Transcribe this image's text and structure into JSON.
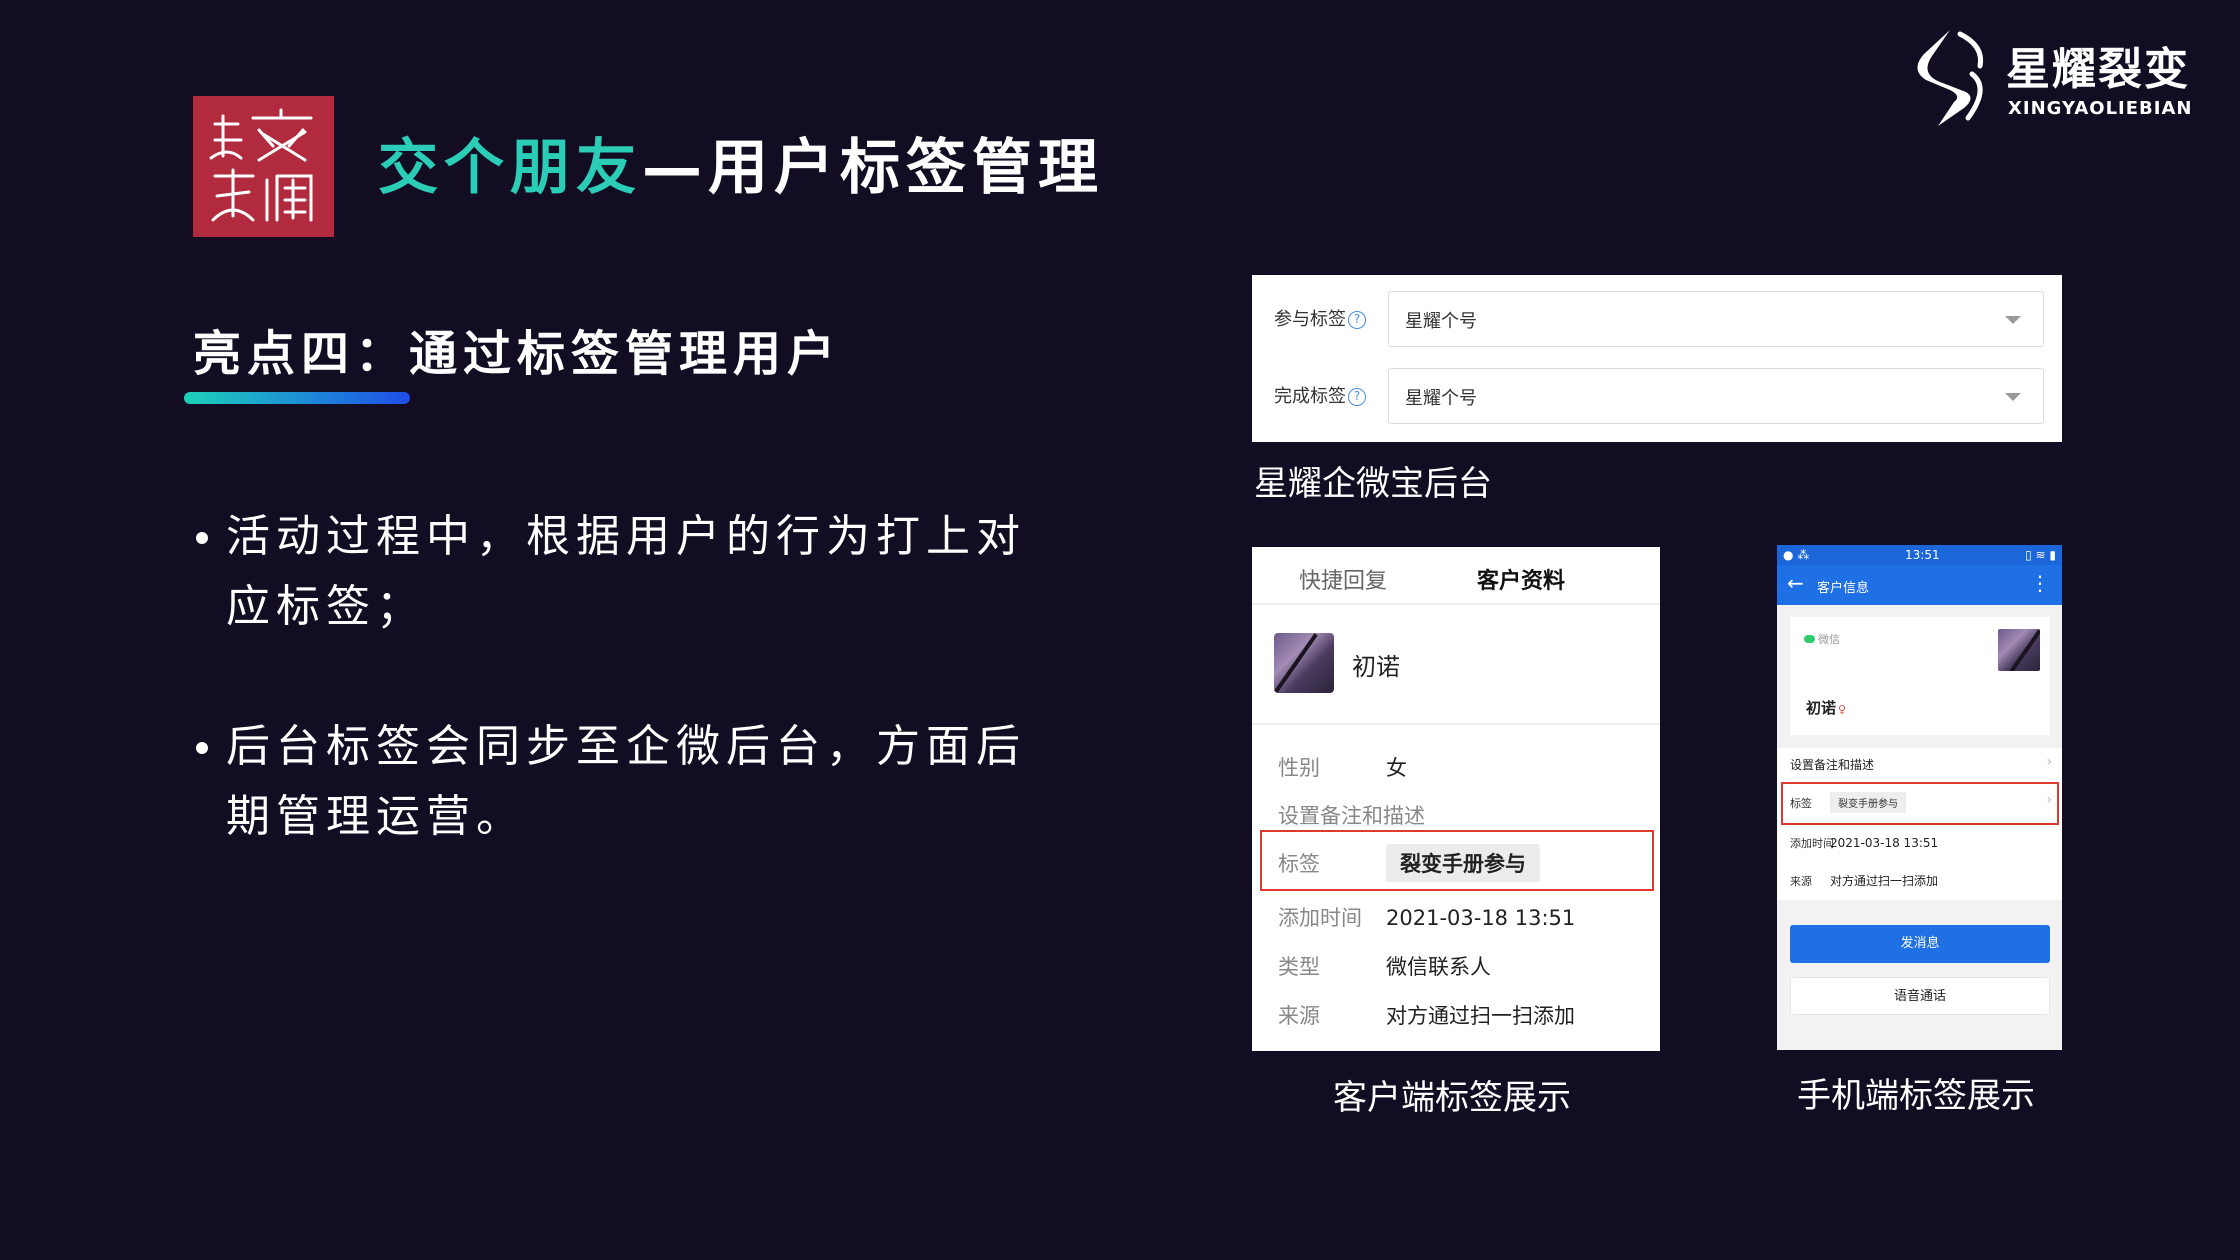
{
  "header": {
    "logo_text": "交个朋友",
    "title_accent": "交个朋友",
    "title_rest": "—用户标签管理"
  },
  "brand": {
    "name_cn": "星耀裂变",
    "name_en": "XINGYAOLIEBIAN"
  },
  "section": {
    "heading": "亮点四：通过标签管理用户"
  },
  "bullets": [
    "活动过程中，根据用户的行为打上对应标签；",
    "后台标签会同步至企微后台，方面后期管理运营。"
  ],
  "backend_panel": {
    "rows": [
      {
        "label": "参与标签",
        "value": "星耀个号"
      },
      {
        "label": "完成标签",
        "value": "星耀个号"
      }
    ],
    "help_icon": "question-circle-icon",
    "caption": "星耀企微宝后台"
  },
  "desktop_panel": {
    "tabs": [
      "快捷回复",
      "客户资料"
    ],
    "contact_name": "初诺",
    "fields": {
      "gender_key": "性别",
      "gender_val": "女",
      "remark": "设置备注和描述",
      "tag_key": "标签",
      "tag_val": "裂变手册参与",
      "time_key": "添加时间",
      "time_val": "2021-03-18 13:51",
      "type_key": "类型",
      "type_val": "微信联系人",
      "source_key": "来源",
      "source_val": "对方通过扫一扫添加"
    },
    "caption": "客户端标签展示"
  },
  "mobile_panel": {
    "status_time": "13:51",
    "nav_title": "客户信息",
    "wechat_label": "微信",
    "contact_name": "初诺",
    "remark": "设置备注和描述",
    "tag_key": "标签",
    "tag_val": "裂变手册参与",
    "time_key": "添加时间",
    "time_val": "2021-03-18 13:51",
    "source_key": "来源",
    "source_val": "对方通过扫一扫添加",
    "primary_button": "发消息",
    "secondary_button": "语音通话",
    "caption": "手机端标签展示"
  },
  "colors": {
    "background": "#120d22",
    "accent_teal": "#2bcdb6",
    "logo_red": "#b12a3d",
    "highlight_red": "#e03a2e",
    "mobile_blue": "#1f6fe5"
  }
}
